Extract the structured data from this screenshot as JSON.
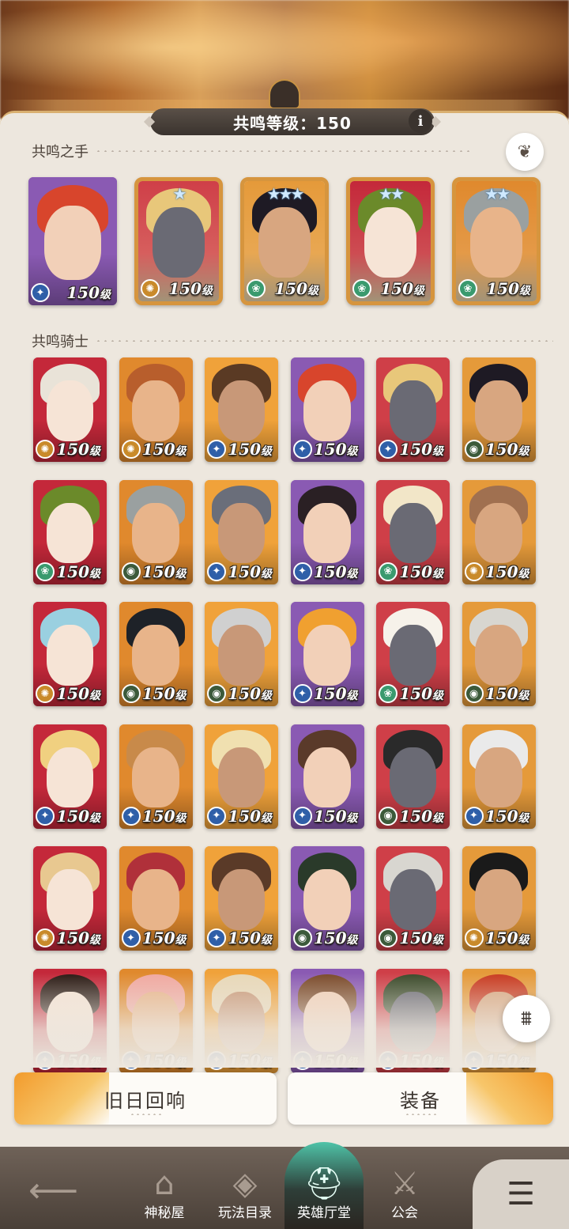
{
  "header": {
    "level_text": "共鸣等级：150",
    "info_icon": "i"
  },
  "sections": {
    "hands_title": "共鸣之手",
    "knights_title": "共鸣骑士"
  },
  "level_label": "150",
  "level_unit": "级",
  "hands": [
    {
      "stars": "",
      "class": "star"
    },
    {
      "stars": "★",
      "class": "gold"
    },
    {
      "stars": "★★★",
      "class": "leaf"
    },
    {
      "stars": "★★",
      "class": "leaf"
    },
    {
      "stars": "★★",
      "class": "leaf"
    }
  ],
  "knights": [
    "gold",
    "gold",
    "star",
    "star",
    "star",
    "eye",
    "leaf",
    "eye",
    "star",
    "star",
    "leaf",
    "gold",
    "gold",
    "eye",
    "eye",
    "star",
    "leaf",
    "eye",
    "star",
    "star",
    "star",
    "star",
    "eye",
    "star",
    "gold",
    "star",
    "star",
    "eye",
    "eye",
    "gold",
    "star",
    "star",
    "star",
    "star",
    "star",
    "star"
  ],
  "buttons": {
    "old_echo": "旧日回响",
    "equipment": "装备"
  },
  "nav": {
    "mystery": "神秘屋",
    "catalog": "玩法目录",
    "heroes": "英雄厅堂",
    "guild": "公会"
  },
  "icons": {
    "back": "arrow-left-icon",
    "menu": "menu-icon",
    "filter": "filter-icon",
    "wing": "wing-icon"
  }
}
